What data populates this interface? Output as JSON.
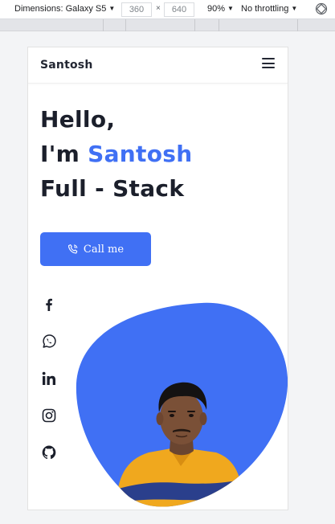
{
  "devtools": {
    "device_label": "Dimensions: Galaxy S5",
    "width_value": "360",
    "height_value": "640",
    "times_sign": "×",
    "zoom_label": "90%",
    "throttle_label": "No throttling"
  },
  "site": {
    "logo": "Santosh",
    "hero": {
      "line1": "Hello,",
      "line2_prefix": "I'm ",
      "line2_name": "Santosh",
      "line3": "Full - Stack"
    },
    "call_button_label": "Call me",
    "social_icons": [
      "facebook-icon",
      "whatsapp-icon",
      "linkedin-icon",
      "instagram-icon",
      "github-icon"
    ]
  },
  "colors": {
    "accent": "#4070f4",
    "heading": "#1b1f2b",
    "page_bg": "#f3f4f6"
  }
}
